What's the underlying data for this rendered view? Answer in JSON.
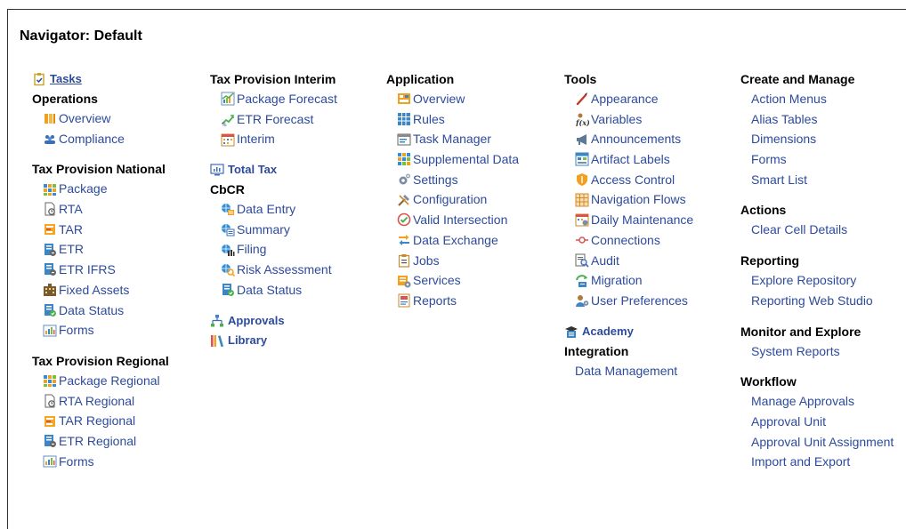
{
  "title": "Navigator: Default",
  "columns": [
    {
      "sections": [
        {
          "type": "toplink",
          "underline": true,
          "label": "Tasks",
          "icon": "clipboard-icon"
        },
        {
          "type": "header",
          "label": "Operations"
        },
        {
          "type": "link",
          "label": "Overview",
          "icon": "overview-bars-icon"
        },
        {
          "type": "link",
          "label": "Compliance",
          "icon": "people-group-icon"
        },
        {
          "type": "gap"
        },
        {
          "type": "header",
          "label": "Tax Provision National"
        },
        {
          "type": "link",
          "label": "Package",
          "icon": "package-grid-icon"
        },
        {
          "type": "link",
          "label": "RTA",
          "icon": "rta-document-icon"
        },
        {
          "type": "link",
          "label": "TAR",
          "icon": "tar-icon"
        },
        {
          "type": "link",
          "label": "ETR",
          "icon": "etr-document-icon"
        },
        {
          "type": "link",
          "label": "ETR IFRS",
          "icon": "etr-document-icon"
        },
        {
          "type": "link",
          "label": "Fixed Assets",
          "icon": "building-icon"
        },
        {
          "type": "link",
          "label": "Data Status",
          "icon": "data-status-icon"
        },
        {
          "type": "link",
          "label": "Forms",
          "icon": "form-chart-icon"
        },
        {
          "type": "gap"
        },
        {
          "type": "header",
          "label": "Tax Provision Regional"
        },
        {
          "type": "link",
          "label": "Package Regional",
          "icon": "package-grid-icon"
        },
        {
          "type": "link",
          "label": "RTA Regional",
          "icon": "rta-document-icon"
        },
        {
          "type": "link",
          "label": "TAR Regional",
          "icon": "tar-icon"
        },
        {
          "type": "link",
          "label": "ETR Regional",
          "icon": "etr-document-icon"
        },
        {
          "type": "link",
          "label": "Forms",
          "icon": "form-chart-icon"
        }
      ]
    },
    {
      "sections": [
        {
          "type": "header",
          "label": "Tax Provision Interim"
        },
        {
          "type": "link",
          "label": "Package Forecast",
          "icon": "forecast-chart-icon"
        },
        {
          "type": "link",
          "label": "ETR Forecast",
          "icon": "trend-arrow-icon"
        },
        {
          "type": "link",
          "label": "Interim",
          "icon": "calendar-icon"
        },
        {
          "type": "gap"
        },
        {
          "type": "toplink",
          "underline": false,
          "label": "Total Tax",
          "icon": "monitor-chart-icon"
        },
        {
          "type": "header",
          "label": "CbCR"
        },
        {
          "type": "link",
          "label": "Data Entry",
          "icon": "globe-entry-icon"
        },
        {
          "type": "link",
          "label": "Summary",
          "icon": "globe-summary-icon"
        },
        {
          "type": "link",
          "label": "Filing",
          "icon": "globe-filing-icon"
        },
        {
          "type": "link",
          "label": "Risk Assessment",
          "icon": "globe-risk-icon"
        },
        {
          "type": "link",
          "label": "Data Status",
          "icon": "data-status-icon"
        },
        {
          "type": "gap"
        },
        {
          "type": "toplink",
          "underline": false,
          "label": "Approvals",
          "icon": "hierarchy-icon"
        },
        {
          "type": "toplink",
          "underline": false,
          "label": "Library",
          "icon": "library-books-icon"
        }
      ]
    },
    {
      "sections": [
        {
          "type": "header",
          "label": "Application"
        },
        {
          "type": "link",
          "label": "Overview",
          "icon": "app-overview-icon"
        },
        {
          "type": "link",
          "label": "Rules",
          "icon": "rules-grid-icon"
        },
        {
          "type": "link",
          "label": "Task Manager",
          "icon": "task-manager-icon"
        },
        {
          "type": "link",
          "label": "Supplemental Data",
          "icon": "supplemental-grid-icon"
        },
        {
          "type": "link",
          "label": "Settings",
          "icon": "gear-icon"
        },
        {
          "type": "link",
          "label": "Configuration",
          "icon": "tools-icon"
        },
        {
          "type": "link",
          "label": "Valid Intersection",
          "icon": "check-circle-icon"
        },
        {
          "type": "link",
          "label": "Data Exchange",
          "icon": "exchange-arrows-icon"
        },
        {
          "type": "link",
          "label": "Jobs",
          "icon": "jobs-clipboard-icon"
        },
        {
          "type": "link",
          "label": "Services",
          "icon": "services-icon"
        },
        {
          "type": "link",
          "label": "Reports",
          "icon": "report-document-icon"
        }
      ]
    },
    {
      "sections": [
        {
          "type": "header",
          "label": "Tools"
        },
        {
          "type": "link",
          "label": "Appearance",
          "icon": "brush-icon"
        },
        {
          "type": "link",
          "label": "Variables",
          "icon": "variables-icon"
        },
        {
          "type": "link",
          "label": "Announcements",
          "icon": "megaphone-icon"
        },
        {
          "type": "link",
          "label": "Artifact Labels",
          "icon": "artifact-labels-icon"
        },
        {
          "type": "link",
          "label": "Access Control",
          "icon": "shield-icon"
        },
        {
          "type": "link",
          "label": "Navigation Flows",
          "icon": "navigation-flows-icon"
        },
        {
          "type": "link",
          "label": "Daily Maintenance",
          "icon": "maintenance-calendar-icon"
        },
        {
          "type": "link",
          "label": "Connections",
          "icon": "connections-icon"
        },
        {
          "type": "link",
          "label": "Audit",
          "icon": "audit-magnifier-icon"
        },
        {
          "type": "link",
          "label": "Migration",
          "icon": "migration-icon"
        },
        {
          "type": "link",
          "label": "User Preferences",
          "icon": "user-preferences-icon"
        },
        {
          "type": "gap"
        },
        {
          "type": "toplink",
          "underline": false,
          "label": "Academy",
          "icon": "academy-icon"
        },
        {
          "type": "header",
          "label": "Integration"
        },
        {
          "type": "link",
          "label": "Data Management",
          "icon": ""
        }
      ]
    },
    {
      "sections": [
        {
          "type": "header",
          "label": "Create and Manage"
        },
        {
          "type": "link",
          "label": "Action Menus",
          "icon": ""
        },
        {
          "type": "link",
          "label": "Alias Tables",
          "icon": ""
        },
        {
          "type": "link",
          "label": "Dimensions",
          "icon": ""
        },
        {
          "type": "link",
          "label": "Forms",
          "icon": ""
        },
        {
          "type": "link",
          "label": "Smart List",
          "icon": ""
        },
        {
          "type": "gap"
        },
        {
          "type": "header",
          "label": "Actions"
        },
        {
          "type": "link",
          "label": "Clear Cell Details",
          "icon": ""
        },
        {
          "type": "gap"
        },
        {
          "type": "header",
          "label": "Reporting"
        },
        {
          "type": "link",
          "label": "Explore Repository",
          "icon": ""
        },
        {
          "type": "link",
          "label": "Reporting Web Studio",
          "icon": ""
        },
        {
          "type": "gap"
        },
        {
          "type": "header",
          "label": "Monitor and Explore"
        },
        {
          "type": "link",
          "label": "System Reports",
          "icon": ""
        },
        {
          "type": "gap"
        },
        {
          "type": "header",
          "label": "Workflow"
        },
        {
          "type": "link",
          "label": "Manage Approvals",
          "icon": ""
        },
        {
          "type": "link",
          "label": "Approval Unit",
          "icon": ""
        },
        {
          "type": "link",
          "label": "Approval Unit Assignment",
          "icon": ""
        },
        {
          "type": "link",
          "label": "Import and Export",
          "icon": ""
        }
      ]
    }
  ]
}
